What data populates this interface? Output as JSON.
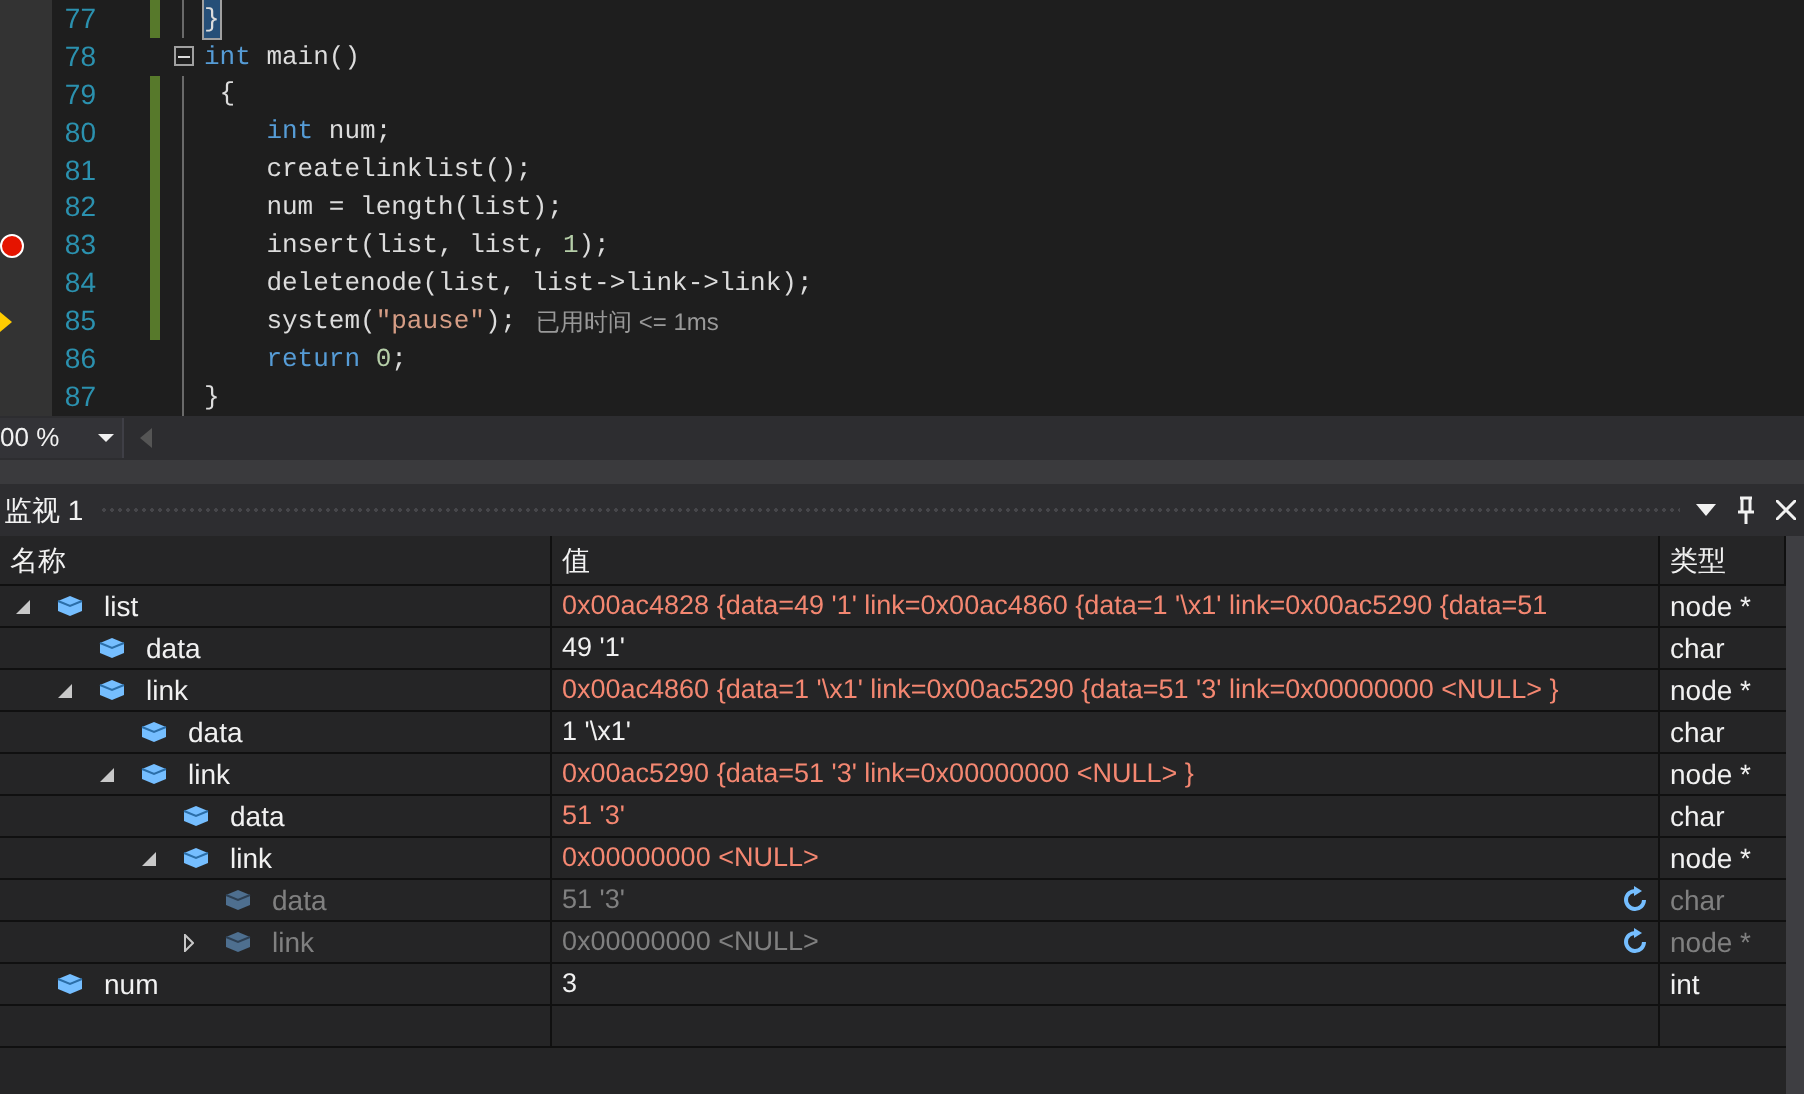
{
  "editor": {
    "lines": [
      {
        "number": "77",
        "changed": true,
        "fold": false,
        "breakpoint": false,
        "current": false,
        "highlighted": true,
        "segments": [
          {
            "text": "}",
            "kind": "plain"
          }
        ]
      },
      {
        "number": "78",
        "changed": false,
        "fold": true,
        "breakpoint": false,
        "current": false,
        "highlighted": false,
        "segments": [
          {
            "text": "int",
            "kind": "keyword"
          },
          {
            "text": " main()",
            "kind": "plain"
          }
        ]
      },
      {
        "number": "79",
        "changed": true,
        "fold": false,
        "breakpoint": false,
        "current": false,
        "highlighted": false,
        "segments": [
          {
            "text": " {",
            "kind": "plain"
          }
        ]
      },
      {
        "number": "80",
        "changed": true,
        "fold": false,
        "breakpoint": false,
        "current": false,
        "highlighted": false,
        "segments": [
          {
            "text": "    int",
            "kind": "keyword"
          },
          {
            "text": " num;",
            "kind": "plain"
          }
        ]
      },
      {
        "number": "81",
        "changed": true,
        "fold": false,
        "breakpoint": false,
        "current": false,
        "highlighted": false,
        "segments": [
          {
            "text": "    createlinklist();",
            "kind": "plain"
          }
        ]
      },
      {
        "number": "82",
        "changed": true,
        "fold": false,
        "breakpoint": false,
        "current": false,
        "highlighted": false,
        "segments": [
          {
            "text": "    num = length(list);",
            "kind": "plain"
          }
        ]
      },
      {
        "number": "83",
        "changed": true,
        "fold": false,
        "breakpoint": true,
        "current": false,
        "highlighted": false,
        "segments": [
          {
            "text": "    insert(list, list, ",
            "kind": "plain"
          },
          {
            "text": "1",
            "kind": "number"
          },
          {
            "text": ");",
            "kind": "plain"
          }
        ]
      },
      {
        "number": "84",
        "changed": true,
        "fold": false,
        "breakpoint": false,
        "current": false,
        "highlighted": false,
        "segments": [
          {
            "text": "    deletenode(list, list->link->link);",
            "kind": "plain"
          }
        ]
      },
      {
        "number": "85",
        "changed": true,
        "fold": false,
        "breakpoint": false,
        "current": true,
        "highlighted": false,
        "hint": "已用时间 <= 1ms",
        "segments": [
          {
            "text": "    system(",
            "kind": "plain"
          },
          {
            "text": "\"pause\"",
            "kind": "string"
          },
          {
            "text": ");",
            "kind": "plain"
          }
        ]
      },
      {
        "number": "86",
        "changed": false,
        "fold": false,
        "breakpoint": false,
        "current": false,
        "highlighted": false,
        "segments": [
          {
            "text": "    return",
            "kind": "keyword"
          },
          {
            "text": " 0",
            "kind": "number"
          },
          {
            "text": ";",
            "kind": "plain"
          }
        ]
      },
      {
        "number": "87",
        "changed": false,
        "fold": false,
        "breakpoint": false,
        "current": false,
        "highlighted": false,
        "segments": [
          {
            "text": "}",
            "kind": "plain"
          }
        ]
      }
    ],
    "zoom": "00 %"
  },
  "watch": {
    "title": "监视 1",
    "columns": [
      "名称",
      "值",
      "类型"
    ],
    "rows": [
      {
        "name": "list",
        "value": "0x00ac4828 {data=49 '1' link=0x00ac4860 {data=1 '\\x1' link=0x00ac5290 {data=51",
        "type": "node *",
        "changed": true,
        "stale": false,
        "expanded": true,
        "children": [
          {
            "name": "data",
            "value": "49 '1'",
            "type": "char",
            "changed": false,
            "stale": false
          },
          {
            "name": "link",
            "value": "0x00ac4860 {data=1 '\\x1' link=0x00ac5290 {data=51 '3' link=0x00000000 <NULL> }",
            "type": "node *",
            "changed": true,
            "stale": false,
            "expanded": true,
            "children": [
              {
                "name": "data",
                "value": "1 '\\x1'",
                "type": "char",
                "changed": false,
                "stale": false
              },
              {
                "name": "link",
                "value": "0x00ac5290 {data=51 '3' link=0x00000000 <NULL> }",
                "type": "node *",
                "changed": true,
                "stale": false,
                "expanded": true,
                "children": [
                  {
                    "name": "data",
                    "value": "51 '3'",
                    "type": "char",
                    "changed": true,
                    "stale": false
                  },
                  {
                    "name": "link",
                    "value": "0x00000000 <NULL>",
                    "type": "node *",
                    "changed": true,
                    "stale": false,
                    "expanded": true,
                    "children": [
                      {
                        "name": "data",
                        "value": "51 '3'",
                        "type": "char",
                        "stale": true
                      },
                      {
                        "name": "link",
                        "value": "0x00000000 <NULL>",
                        "type": "node *",
                        "stale": true,
                        "expanded": false
                      }
                    ]
                  }
                ]
              }
            ]
          }
        ]
      },
      {
        "name": "num",
        "value": "3",
        "type": "int",
        "changed": false,
        "stale": false
      }
    ]
  }
}
